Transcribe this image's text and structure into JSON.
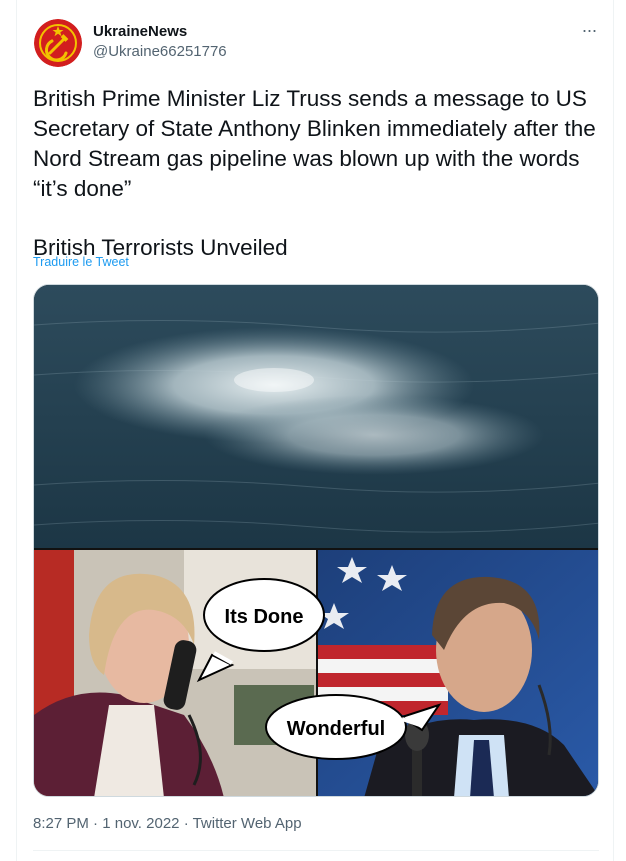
{
  "author": {
    "name": "UkraineNews",
    "handle": "@Ukraine66251776",
    "avatar_icon": "hammer-sickle-icon",
    "avatar_color": "#d21e1e"
  },
  "menu": {
    "more_icon": "more-horizontal-icon",
    "more_label": "···"
  },
  "tweet": {
    "text": "British Prime Minister Liz Truss sends a message to US Secretary of State Anthony Blinken immediately after the Nord Stream gas pipeline was blown up with the words “it’s done”",
    "text2": "British Terrorists Unveiled",
    "translate_label": "Traduire le Tweet"
  },
  "media": {
    "bubble_left": "Its Done",
    "bubble_right": "Wonderful"
  },
  "meta": {
    "time": "8:27 PM",
    "separator": "·",
    "date": "1 nov. 2022",
    "source": "Twitter Web App"
  },
  "colors": {
    "link": "#1d9bf0",
    "secondary": "#536471"
  }
}
